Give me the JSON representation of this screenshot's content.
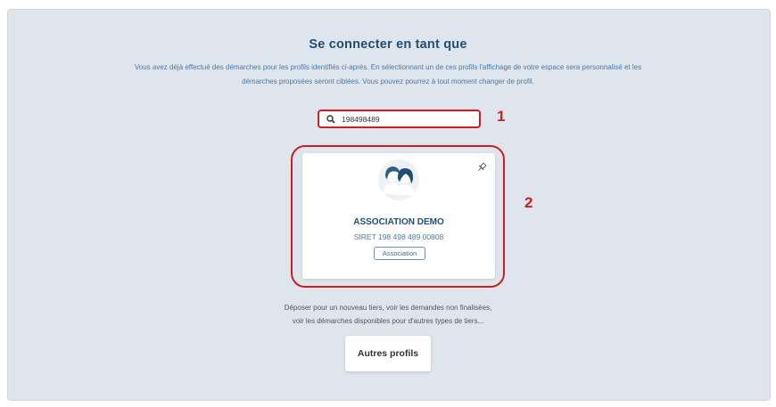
{
  "header": {
    "title": "Se connecter en tant que",
    "description": "Vous avez déjà effectué des démarches pour les profils identifiés ci-après. En sélectionnant un de ces profils l'affichage de votre espace sera personnalisé et les démarches proposées seront ciblées. Vous pouvez pourrez à tout moment changer de profil."
  },
  "search": {
    "icon": "search-icon",
    "value": "198498489"
  },
  "annotations": {
    "search_marker": "1",
    "card_marker": "2",
    "color": "#d01e1e"
  },
  "profile_card": {
    "icon": "group-avatar-icon",
    "pin_icon": "pin-icon",
    "name": "ASSOCIATION DEMO",
    "siret": "SIRET 198 498 489 00808",
    "badge": "Association"
  },
  "footer": {
    "line1": "Déposer pour un nouveau tiers, voir les demandes non finalisées,",
    "line2": "voir les démarches disponibles pour d'autres types de tiers...",
    "button_label": "Autres profils"
  },
  "colors": {
    "background": "#dfe5ec",
    "title": "#1f4e79",
    "accent": "#4a79a8"
  }
}
